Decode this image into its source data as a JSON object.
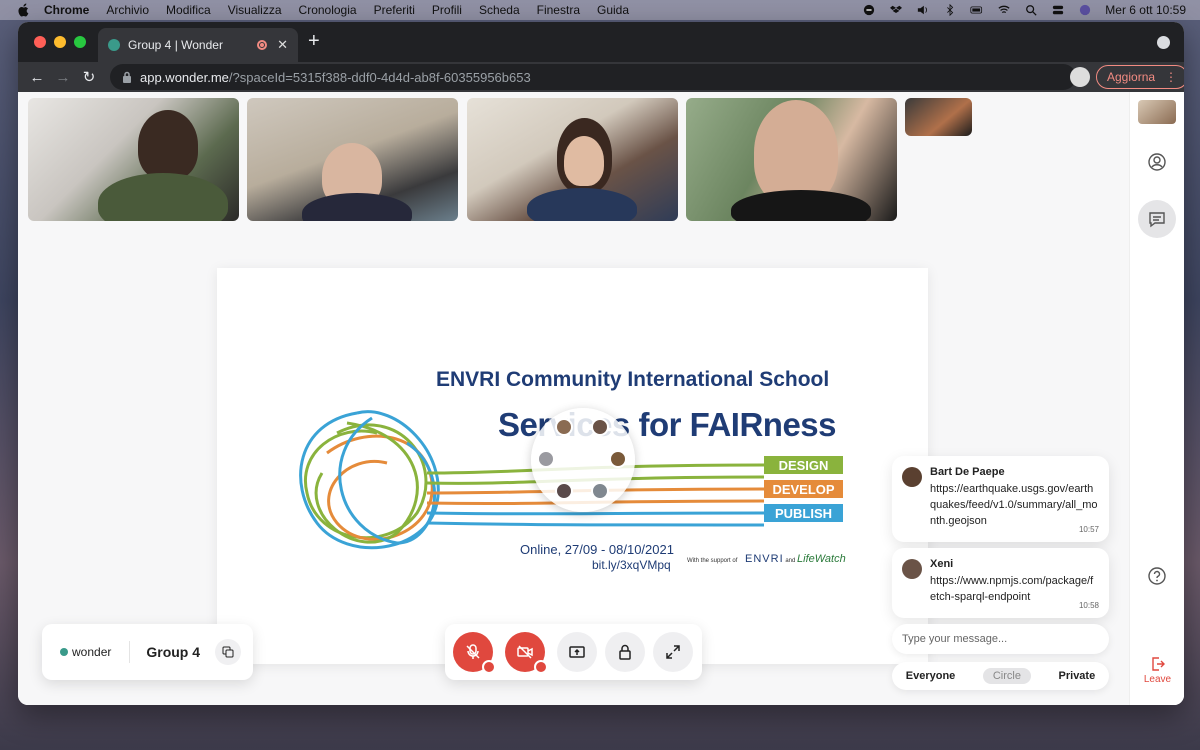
{
  "menubar": {
    "items": [
      "Chrome",
      "Archivio",
      "Modifica",
      "Visualizza",
      "Cronologia",
      "Preferiti",
      "Profili",
      "Scheda",
      "Finestra",
      "Guida"
    ],
    "datetime": "Mer 6 ott  10:59"
  },
  "browser": {
    "tab_title": "Group 4 | Wonder",
    "url_host": "app.wonder.me",
    "url_path": "/?spaceId=5315f388-ddf0-4d4d-ab8f-60355956b653",
    "update_label": "Aggiorna"
  },
  "slide": {
    "title1": "ENVRI Community International School",
    "title2": "Services for FAIRness",
    "bars": [
      "DESIGN",
      "DEVELOP",
      "PUBLISH"
    ],
    "dates": "Online, 27/09 - 08/10/2021",
    "link": "bit.ly/3xqVMpq",
    "support": "With the support of",
    "envri": "ENVRI",
    "and": "and",
    "lifewatch": "LifeWatch"
  },
  "group": {
    "brand": "wonder",
    "name": "Group 4"
  },
  "chat": {
    "messages": [
      {
        "author": "Bart De Paepe",
        "text": "https://earthquake.usgs.gov/earthquakes/feed/v1.0/summary/all_month.geojson",
        "time": "10:57"
      },
      {
        "author": "Xeni",
        "text": "https://www.npmjs.com/package/fetch-sparql-endpoint",
        "time": "10:58"
      }
    ],
    "placeholder": "Type your message...",
    "tabs": [
      "Everyone",
      "Circle",
      "Private"
    ]
  },
  "sidebar": {
    "leave_label": "Leave"
  },
  "colors": {
    "accent_red": "#e0483e",
    "brand_teal": "#3a9a8a",
    "slide_navy": "#1f3c75"
  }
}
